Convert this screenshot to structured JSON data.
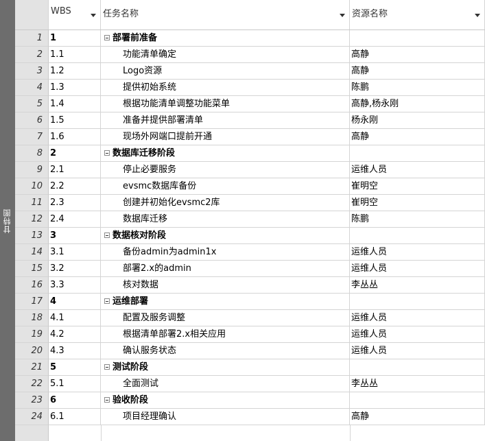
{
  "sidebar": {
    "label": "甘特图"
  },
  "columns": {
    "wbs": "WBS",
    "name": "任务名称",
    "resource": "资源名称"
  },
  "rows": [
    {
      "num": "1",
      "wbs": "1",
      "name": "部署前准备",
      "resource": "",
      "summary": true
    },
    {
      "num": "2",
      "wbs": "1.1",
      "name": "功能清单确定",
      "resource": "高静",
      "summary": false
    },
    {
      "num": "3",
      "wbs": "1.2",
      "name": "Logo资源",
      "resource": "高静",
      "summary": false
    },
    {
      "num": "4",
      "wbs": "1.3",
      "name": "提供初始系统",
      "resource": "陈鹏",
      "summary": false
    },
    {
      "num": "5",
      "wbs": "1.4",
      "name": "根据功能清单调整功能菜单",
      "resource": "高静,杨永刚",
      "summary": false
    },
    {
      "num": "6",
      "wbs": "1.5",
      "name": "准备并提供部署清单",
      "resource": "杨永刚",
      "summary": false
    },
    {
      "num": "7",
      "wbs": "1.6",
      "name": "现场外网端口提前开通",
      "resource": "高静",
      "summary": false
    },
    {
      "num": "8",
      "wbs": "2",
      "name": "数据库迁移阶段",
      "resource": "",
      "summary": true
    },
    {
      "num": "9",
      "wbs": "2.1",
      "name": "停止必要服务",
      "resource": "运维人员",
      "summary": false
    },
    {
      "num": "10",
      "wbs": "2.2",
      "name": "evsmc数据库备份",
      "resource": "崔明空",
      "summary": false
    },
    {
      "num": "11",
      "wbs": "2.3",
      "name": "创建并初始化evsmc2库",
      "resource": "崔明空",
      "summary": false
    },
    {
      "num": "12",
      "wbs": "2.4",
      "name": "数据库迁移",
      "resource": "陈鹏",
      "summary": false
    },
    {
      "num": "13",
      "wbs": "3",
      "name": "数据核对阶段",
      "resource": "",
      "summary": true
    },
    {
      "num": "14",
      "wbs": "3.1",
      "name": "备份admin为admin1x",
      "resource": "运维人员",
      "summary": false
    },
    {
      "num": "15",
      "wbs": "3.2",
      "name": "部署2.x的admin",
      "resource": "运维人员",
      "summary": false
    },
    {
      "num": "16",
      "wbs": "3.3",
      "name": "核对数据",
      "resource": "李丛丛",
      "summary": false
    },
    {
      "num": "17",
      "wbs": "4",
      "name": "运维部署",
      "resource": "",
      "summary": true
    },
    {
      "num": "18",
      "wbs": "4.1",
      "name": "配置及服务调整",
      "resource": "运维人员",
      "summary": false
    },
    {
      "num": "19",
      "wbs": "4.2",
      "name": "根据清单部署2.x相关应用",
      "resource": "运维人员",
      "summary": false
    },
    {
      "num": "20",
      "wbs": "4.3",
      "name": "确认服务状态",
      "resource": "运维人员",
      "summary": false
    },
    {
      "num": "21",
      "wbs": "5",
      "name": "测试阶段",
      "resource": "",
      "summary": true
    },
    {
      "num": "22",
      "wbs": "5.1",
      "name": "全面测试",
      "resource": "李丛丛",
      "summary": false
    },
    {
      "num": "23",
      "wbs": "6",
      "name": "验收阶段",
      "resource": "",
      "summary": true
    },
    {
      "num": "24",
      "wbs": "6.1",
      "name": "项目经理确认",
      "resource": "高静",
      "summary": false
    }
  ]
}
